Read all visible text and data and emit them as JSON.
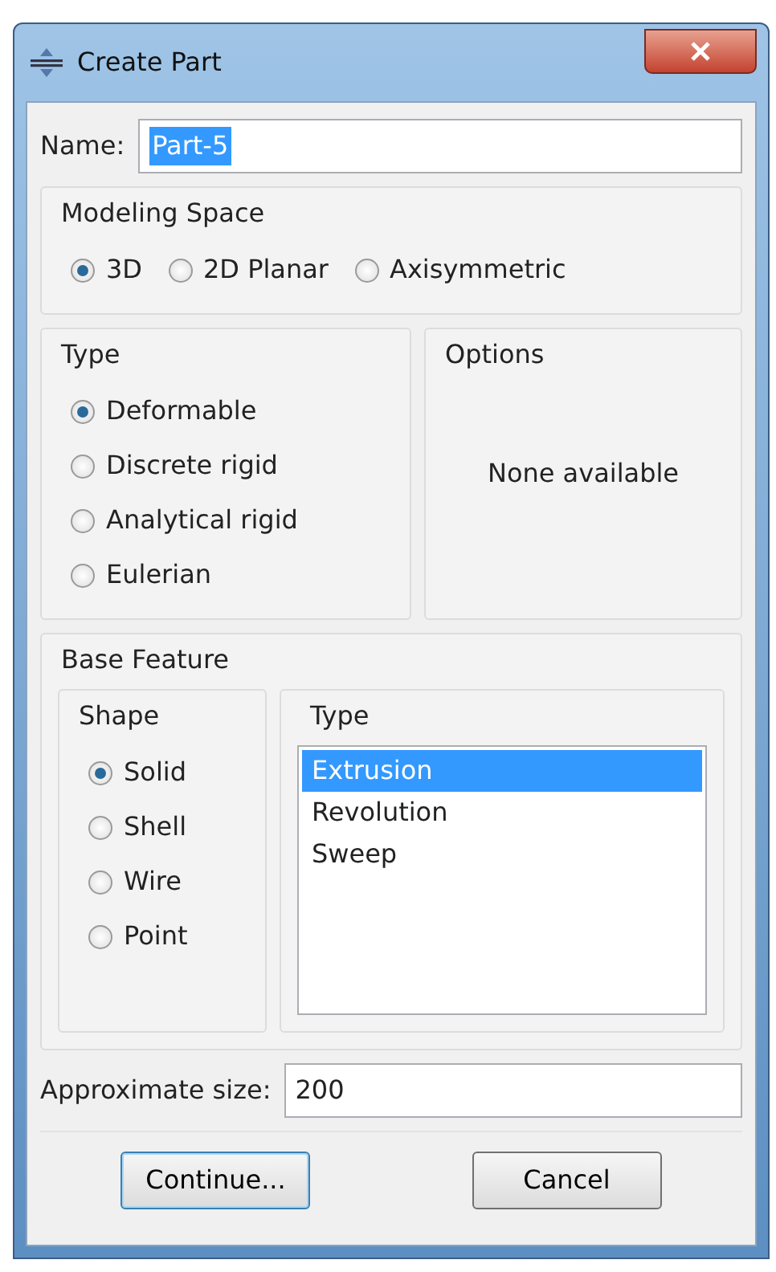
{
  "window": {
    "title": "Create Part"
  },
  "name": {
    "label": "Name:",
    "value": "Part-5",
    "highlighted": true
  },
  "modeling_space": {
    "title": "Modeling Space",
    "options": [
      {
        "label": "3D",
        "selected": true
      },
      {
        "label": "2D Planar",
        "selected": false
      },
      {
        "label": "Axisymmetric",
        "selected": false
      }
    ]
  },
  "type": {
    "title": "Type",
    "options": [
      {
        "label": "Deformable",
        "selected": true
      },
      {
        "label": "Discrete rigid",
        "selected": false
      },
      {
        "label": "Analytical rigid",
        "selected": false
      },
      {
        "label": "Eulerian",
        "selected": false
      }
    ]
  },
  "options": {
    "title": "Options",
    "text": "None available"
  },
  "base_feature": {
    "title": "Base Feature",
    "shape": {
      "title": "Shape",
      "options": [
        {
          "label": "Solid",
          "selected": true
        },
        {
          "label": "Shell",
          "selected": false
        },
        {
          "label": "Wire",
          "selected": false
        },
        {
          "label": "Point",
          "selected": false
        }
      ]
    },
    "type": {
      "title": "Type",
      "items": [
        {
          "label": "Extrusion",
          "selected": true
        },
        {
          "label": "Revolution",
          "selected": false
        },
        {
          "label": "Sweep",
          "selected": false
        }
      ]
    }
  },
  "approximate_size": {
    "label": "Approximate size:",
    "value": "200"
  },
  "buttons": [
    {
      "label": "Continue...",
      "default": true
    },
    {
      "label": "Cancel",
      "default": false
    }
  ]
}
